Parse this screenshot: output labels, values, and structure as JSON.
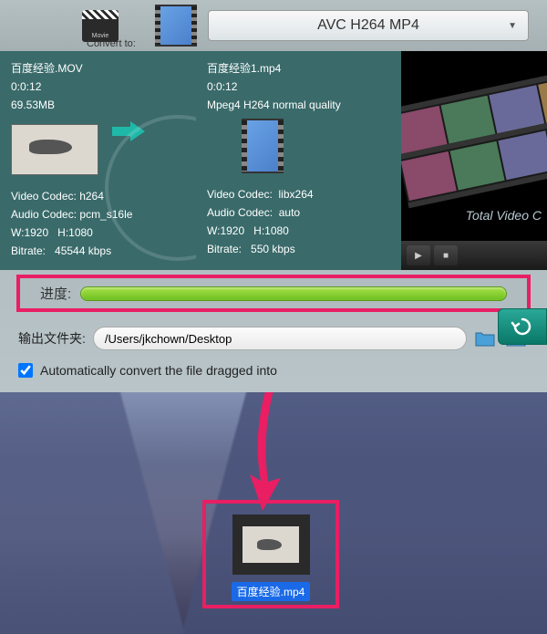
{
  "header": {
    "convert_to_label": "Convert to:",
    "movie_badge": "Movie",
    "format_selected": "AVC H264 MP4"
  },
  "source": {
    "filename": "百度经验.MOV",
    "duration": "0:0:12",
    "filesize": "69.53MB",
    "video_codec_label": "Video Codec:",
    "video_codec": "h264",
    "audio_codec_label": "Audio Codec:",
    "audio_codec": "pcm_s16le",
    "w_label": "W:1920",
    "h_label": "H:1080",
    "bitrate_label": "Bitrate:",
    "bitrate": "45544 kbps"
  },
  "destination": {
    "filename": "百度经验1.mp4",
    "duration": "0:0:12",
    "quality": "Mpeg4 H264 normal quality",
    "video_codec_label": "Video Codec:",
    "video_codec": "libx264",
    "audio_codec_label": "Audio Codec:",
    "audio_codec": "auto",
    "w_label": "W:1920",
    "h_label": "H:1080",
    "bitrate_label": "Bitrate:",
    "bitrate": "550 kbps"
  },
  "preview": {
    "title": "Total Video C"
  },
  "progress": {
    "label": "进度:"
  },
  "output": {
    "label": "输出文件夹:",
    "path": "/Users/jkchown/Desktop"
  },
  "auto_convert": {
    "checked": true,
    "label": "Automatically convert the file dragged into"
  },
  "desktop_file": {
    "name": "百度经验.mp4"
  }
}
